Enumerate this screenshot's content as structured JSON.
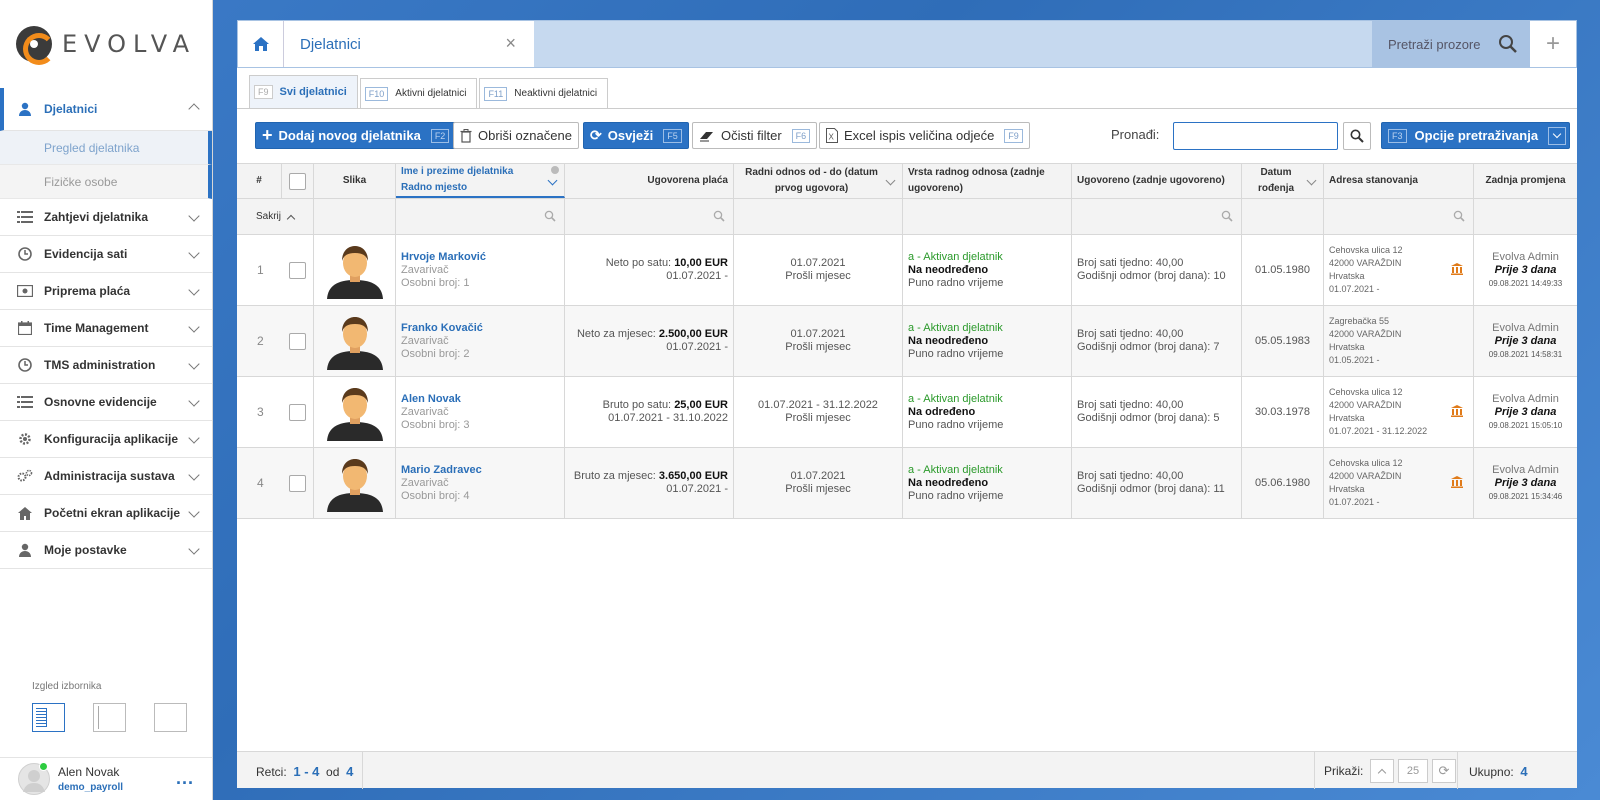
{
  "app": {
    "logo_text": "EVOLVA"
  },
  "sidebar": {
    "items": [
      {
        "label": "Djelatnici",
        "icon": "user-icon",
        "active": true
      },
      {
        "label": "Zahtjevi djelatnika",
        "icon": "list-icon"
      },
      {
        "label": "Evidencija sati",
        "icon": "clock-icon"
      },
      {
        "label": "Priprema plaća",
        "icon": "money-icon"
      },
      {
        "label": "Time Management",
        "icon": "calendar-icon"
      },
      {
        "label": "TMS administration",
        "icon": "clock-icon"
      },
      {
        "label": "Osnovne evidencije",
        "icon": "list-icon"
      },
      {
        "label": "Konfiguracija aplikacije",
        "icon": "gear-icon"
      },
      {
        "label": "Administracija sustava",
        "icon": "gears-icon"
      },
      {
        "label": "Početni ekran aplikacije",
        "icon": "home-icon"
      },
      {
        "label": "Moje postavke",
        "icon": "user-icon"
      }
    ],
    "subitems": [
      {
        "label": "Pregled djelatnika",
        "selected": true
      },
      {
        "label": "Fizičke osobe"
      }
    ],
    "menu_layout_label": "Izgled izbornika",
    "user": {
      "name": "Alen Novak",
      "role": "demo_payroll",
      "more": "..."
    }
  },
  "tabs": {
    "window_title": "Djelatnici",
    "close": "×",
    "search_windows": "Pretraži prozore",
    "plus": "+"
  },
  "subtabs": [
    {
      "key": "F9",
      "label": "Svi djelatnici",
      "active": true
    },
    {
      "key": "F10",
      "label": "Aktivni djelatnici"
    },
    {
      "key": "F11",
      "label": "Neaktivni djelatnici"
    }
  ],
  "toolbar": {
    "add": {
      "label": "Dodaj novog djelatnika",
      "key": "F2"
    },
    "delete": {
      "label": "Obriši označene"
    },
    "refresh": {
      "label": "Osvježi",
      "key": "F5"
    },
    "clear_filter": {
      "label": "Očisti filter",
      "key": "F6"
    },
    "excel": {
      "label": "Excel ispis veličina odjeće",
      "key": "F9"
    },
    "find_label": "Pronađi:",
    "search_options": {
      "key": "F3",
      "label": "Opcije pretraživanja"
    }
  },
  "table": {
    "headers": {
      "num": "#",
      "photo": "Slika",
      "name_line1": "Ime i prezime djelatnika",
      "name_line2": "Radno mjesto",
      "salary": "Ugovorena plaća",
      "employment": "Radni odnos od - do (datum prvog ugovora)",
      "type": "Vrsta radnog odnosa (zadnje ugovoreno)",
      "agreed": "Ugovoreno (zadnje ugovoreno)",
      "dob": "Datum rođenja",
      "address": "Adresa stanovanja",
      "last_change": "Zadnja promjena"
    },
    "hide_label": "Sakrij",
    "rows": [
      {
        "num": "1",
        "name": "Hrvoje Marković",
        "position": "Zavarivač",
        "id_no": "Osobni broj: 1",
        "salary_label": "Neto po satu:",
        "salary_value": "10,00 EUR",
        "salary_period": "01.07.2021 -",
        "emp_dates": "01.07.2021",
        "emp_note": "Prošli mjesec",
        "status": "a - Aktivan djelatnik",
        "contract": "Na neodređeno",
        "worktime": "Puno radno vrijeme",
        "hours": "Broj sati tjedno: 40,00",
        "vacation": "Godišnji odmor (broj dana): 10",
        "dob": "01.05.1980",
        "addr1": "Cehovska ulica 12",
        "addr2": "42000 VARAŽDIN",
        "addr3": "Hrvatska",
        "addr4": "01.07.2021 -",
        "bank": true,
        "changed_by": "Evolva Admin",
        "changed_ago": "Prije 3 dana",
        "changed_at": "09.08.2021 14:49:33"
      },
      {
        "num": "2",
        "name": "Franko Kovačić",
        "position": "Zavarivač",
        "id_no": "Osobni broj: 2",
        "salary_label": "Neto za mjesec:",
        "salary_value": "2.500,00 EUR",
        "salary_period": "01.07.2021 -",
        "emp_dates": "01.07.2021",
        "emp_note": "Prošli mjesec",
        "status": "a - Aktivan djelatnik",
        "contract": "Na neodređeno",
        "worktime": "Puno radno vrijeme",
        "hours": "Broj sati tjedno: 40,00",
        "vacation": "Godišnji odmor (broj dana): 7",
        "dob": "05.05.1983",
        "addr1": "Zagrebačka 55",
        "addr2": "42000 VARAŽDIN",
        "addr3": "Hrvatska",
        "addr4": "01.05.2021 -",
        "bank": false,
        "changed_by": "Evolva Admin",
        "changed_ago": "Prije 3 dana",
        "changed_at": "09.08.2021 14:58:31"
      },
      {
        "num": "3",
        "name": "Alen Novak",
        "position": "Zavarivač",
        "id_no": "Osobni broj: 3",
        "salary_label": "Bruto po satu:",
        "salary_value": "25,00 EUR",
        "salary_period": "01.07.2021 - 31.10.2022",
        "emp_dates": "01.07.2021 - 31.12.2022",
        "emp_note": "Prošli mjesec",
        "status": "a - Aktivan djelatnik",
        "contract": "Na određeno",
        "worktime": "Puno radno vrijeme",
        "hours": "Broj sati tjedno: 40,00",
        "vacation": "Godišnji odmor (broj dana): 5",
        "dob": "30.03.1978",
        "addr1": "Cehovska ulica 12",
        "addr2": "42000 VARAŽDIN",
        "addr3": "Hrvatska",
        "addr4": "01.07.2021 - 31.12.2022",
        "bank": true,
        "changed_by": "Evolva Admin",
        "changed_ago": "Prije 3 dana",
        "changed_at": "09.08.2021 15:05:10"
      },
      {
        "num": "4",
        "name": "Mario Zadravec",
        "position": "Zavarivač",
        "id_no": "Osobni broj: 4",
        "salary_label": "Bruto za mjesec:",
        "salary_value": "3.650,00 EUR",
        "salary_period": "01.07.2021 -",
        "emp_dates": "01.07.2021",
        "emp_note": "Prošli mjesec",
        "status": "a - Aktivan djelatnik",
        "contract": "Na neodređeno",
        "worktime": "Puno radno vrijeme",
        "hours": "Broj sati tjedno: 40,00",
        "vacation": "Godišnji odmor (broj dana): 11",
        "dob": "05.06.1980",
        "addr1": "Cehovska ulica 12",
        "addr2": "42000 VARAŽDIN",
        "addr3": "Hrvatska",
        "addr4": "01.07.2021 -",
        "bank": true,
        "changed_by": "Evolva Admin",
        "changed_ago": "Prije 3 dana",
        "changed_at": "09.08.2021 15:34:46"
      }
    ]
  },
  "footer": {
    "rows_label": "Retci:",
    "range": "1 - 4",
    "of": "od",
    "total_rows": "4",
    "show_label": "Prikaži:",
    "page_size": "25",
    "total_label": "Ukupno:",
    "total_value": "4"
  },
  "colors": {
    "accent": "#2b72c4",
    "brand_orange": "#f28c1b",
    "status_green": "#2b9a2b"
  }
}
